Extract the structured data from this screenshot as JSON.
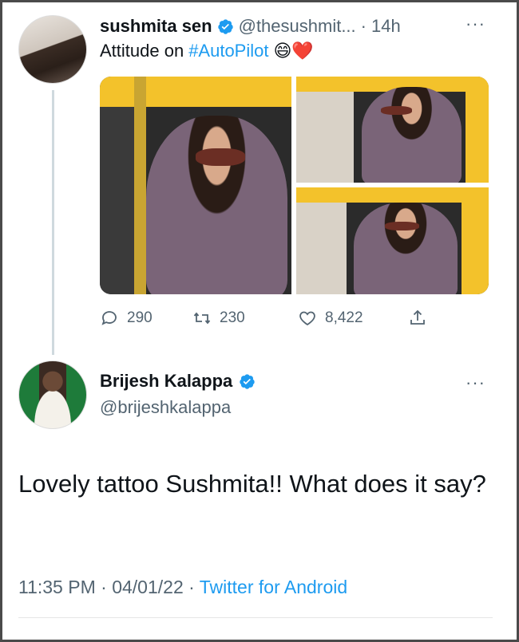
{
  "tweet": {
    "display_name": "sushmita sen",
    "handle": "@thesushmit...",
    "separator": "·",
    "time": "14h",
    "more": "···",
    "text_prefix": "Attitude on",
    "hashtag": "#AutoPilot",
    "emojis": "😄❤️",
    "photos": [
      "photo-1",
      "photo-2",
      "photo-3"
    ],
    "stats": {
      "replies": "290",
      "retweets": "230",
      "likes": "8,422"
    }
  },
  "reply": {
    "display_name": "Brijesh Kalappa",
    "handle": "@brijeshkalappa",
    "more": "···",
    "text": "Lovely tattoo Sushmita!! What does it say?",
    "time": "11:35 PM",
    "date": "04/01/22",
    "separator": "·",
    "source": "Twitter for Android"
  },
  "colors": {
    "accent": "#1d9bf0",
    "text": "#0f1419",
    "muted": "#536471"
  },
  "icons": [
    "verified-badge-icon",
    "reply-icon",
    "retweet-icon",
    "like-icon",
    "share-icon",
    "more-icon"
  ]
}
